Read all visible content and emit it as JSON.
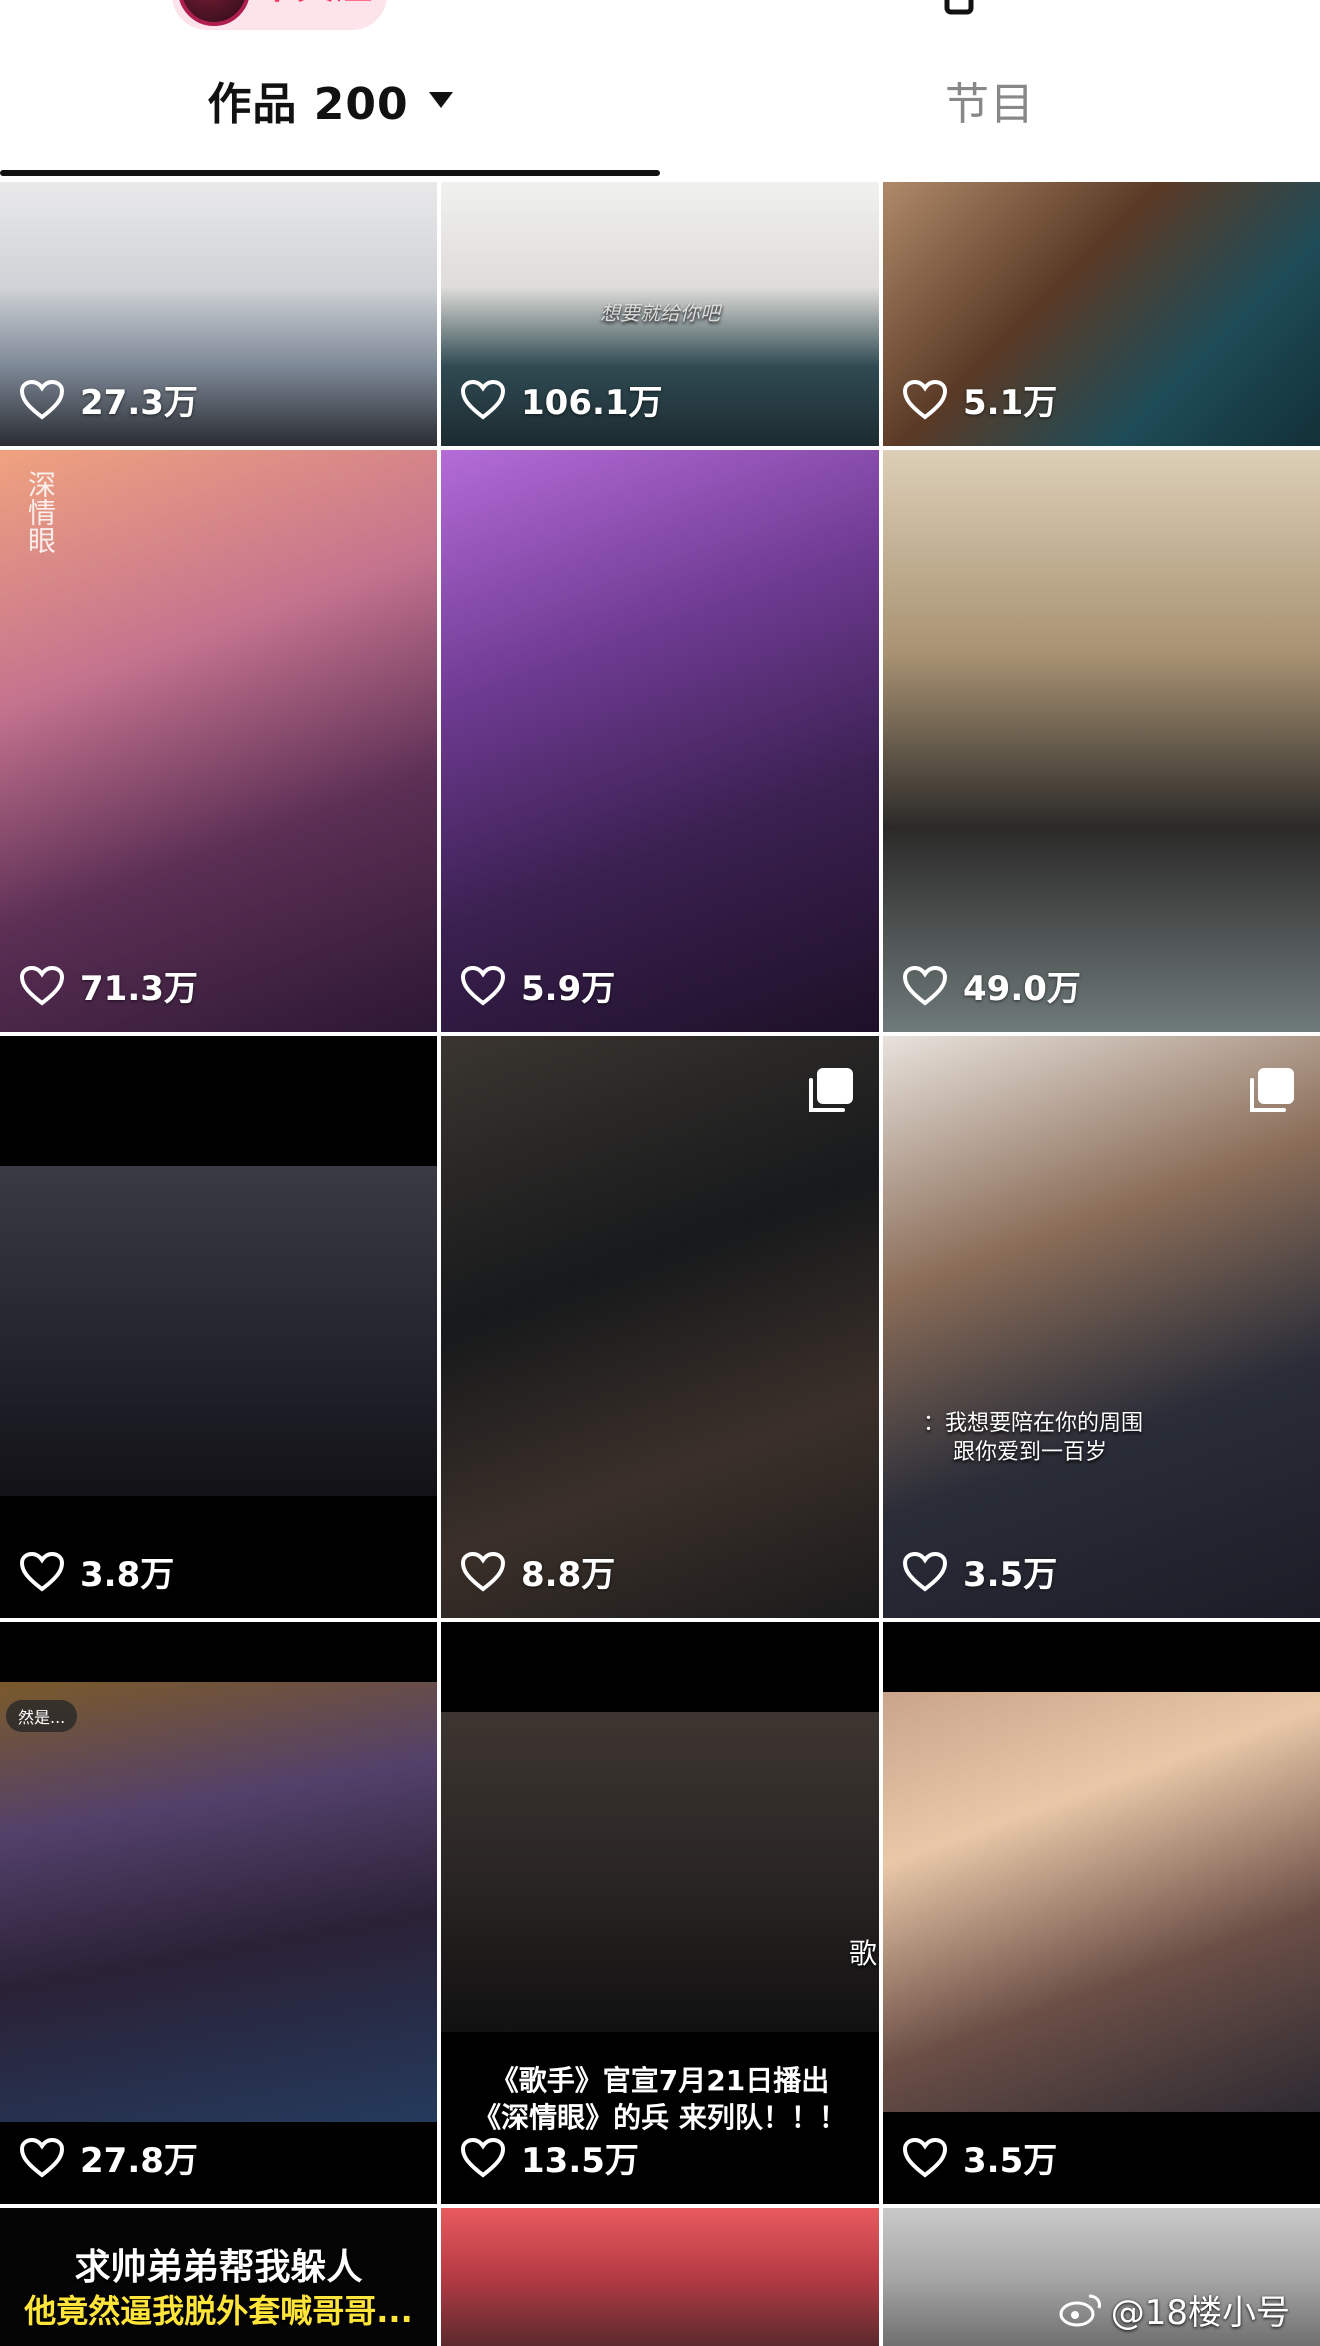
{
  "header": {
    "follow_label": "十关注"
  },
  "tabs": [
    {
      "label": "作品 200"
    },
    {
      "label": "节目"
    }
  ],
  "grid": [
    {
      "likes": "27.3万"
    },
    {
      "likes": "106.1万",
      "caption": "想要就给你吧"
    },
    {
      "likes": "5.1万"
    },
    {
      "likes": "71.3万",
      "logo": "深情眼"
    },
    {
      "likes": "5.9万"
    },
    {
      "likes": "49.0万"
    },
    {
      "likes": "3.8万"
    },
    {
      "likes": "8.8万",
      "multi": true
    },
    {
      "likes": "3.5万",
      "multi": true,
      "caption_line1": "：我想要陪在你的周围",
      "caption_line2": "跟你爱到一百岁"
    },
    {
      "likes": "27.8万",
      "tag": "然是..."
    },
    {
      "likes": "13.5万",
      "caption_line1": "《歌手》官宣7月21日播出",
      "caption_line2": "《深情眼》的兵 来列队！！！",
      "side_text": "歌"
    },
    {
      "likes": "3.5万"
    },
    {
      "caption_line1": "求帅弟弟帮我躲人",
      "caption_line2": "他竟然逼我脱外套喊哥哥..."
    },
    {},
    {}
  ],
  "watermark": "@18楼小号",
  "colors": {
    "accent": "#ff2d5c",
    "follow_bg": "#fde3ea",
    "tab_active": "#111111",
    "tab_inactive": "#888888"
  }
}
